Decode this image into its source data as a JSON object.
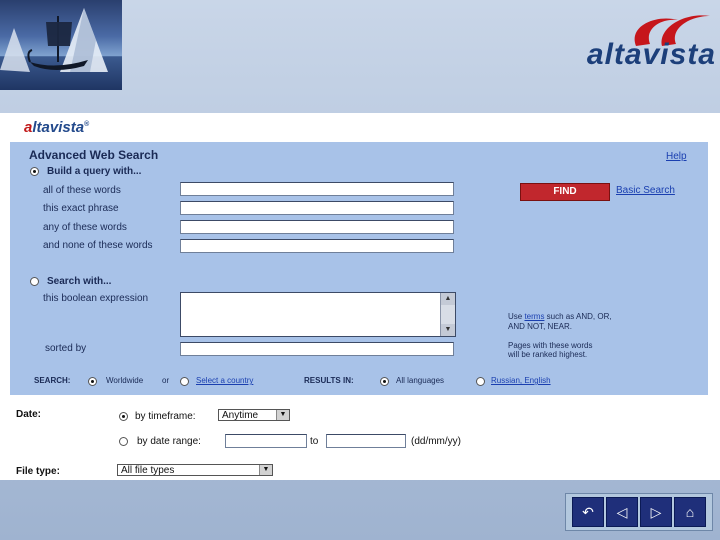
{
  "brand": {
    "wordmark": "altavista"
  },
  "inner_logo": {
    "prefix": "a",
    "rest": "ltavista",
    "tm": "®"
  },
  "header": {
    "title": "Advanced Web Search",
    "help": "Help"
  },
  "build_query": {
    "label": "Build a query with...",
    "rows": [
      {
        "label": "all of these words",
        "value": ""
      },
      {
        "label": "this exact phrase",
        "value": ""
      },
      {
        "label": "any of these words",
        "value": ""
      },
      {
        "label": "and none of these words",
        "value": ""
      }
    ],
    "find_label": "FIND",
    "basic_link": "Basic Search"
  },
  "search_with": {
    "label": "Search with...",
    "boolean_label": "this boolean expression",
    "boolean_value": "",
    "hint_pre": "Use ",
    "hint_link": "terms",
    "hint_post": " such as AND, OR,",
    "hint_line2": "AND NOT, NEAR.",
    "sorted_label": "sorted by",
    "sorted_value": "",
    "sorted_hint1": "Pages with these words",
    "sorted_hint2": "will be ranked highest."
  },
  "scope": {
    "search_label": "SEARCH:",
    "worldwide": "Worldwide",
    "or": "or",
    "select_country": "Select a country",
    "results_label": "RESULTS IN:",
    "all_languages": "All languages",
    "russian_english": "Russian, English"
  },
  "date": {
    "label": "Date:",
    "by_timeframe": "by timeframe:",
    "timeframe_value": "Anytime",
    "by_range": "by date range:",
    "from_value": "",
    "to_label": "to",
    "to_value": "",
    "format": "(dd/mm/yy)"
  },
  "filetype": {
    "label": "File type:",
    "value": "All file types"
  },
  "nav": {
    "icons": [
      "return-icon",
      "previous-icon",
      "next-icon",
      "home-icon"
    ]
  }
}
